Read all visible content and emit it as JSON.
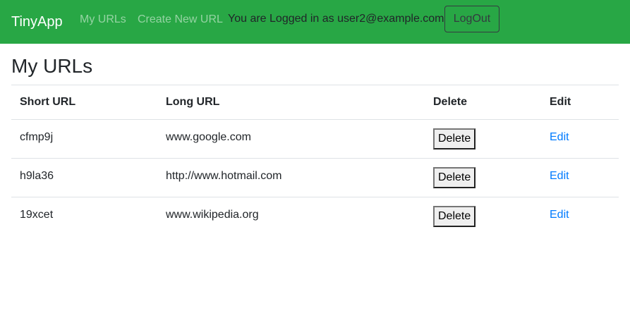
{
  "navbar": {
    "brand": "TinyApp",
    "links": [
      {
        "label": "My URLs"
      },
      {
        "label": "Create New URL"
      }
    ],
    "logged_in_text": "You are Logged in as user2@example.com",
    "logout_label": "LogOut"
  },
  "page": {
    "title": "My URLs"
  },
  "table": {
    "headers": {
      "short": "Short URL",
      "long": "Long URL",
      "delete": "Delete",
      "edit": "Edit"
    },
    "rows": [
      {
        "short": "cfmp9j",
        "long": "www.google.com",
        "delete_label": "Delete",
        "edit_label": "Edit"
      },
      {
        "short": "h9la36",
        "long": "http://www.hotmail.com",
        "delete_label": "Delete",
        "edit_label": "Edit"
      },
      {
        "short": "19xcet",
        "long": "www.wikipedia.org",
        "delete_label": "Delete",
        "edit_label": "Edit"
      }
    ]
  },
  "colors": {
    "navbar_bg": "#28a745",
    "link_blue": "#007bff"
  }
}
